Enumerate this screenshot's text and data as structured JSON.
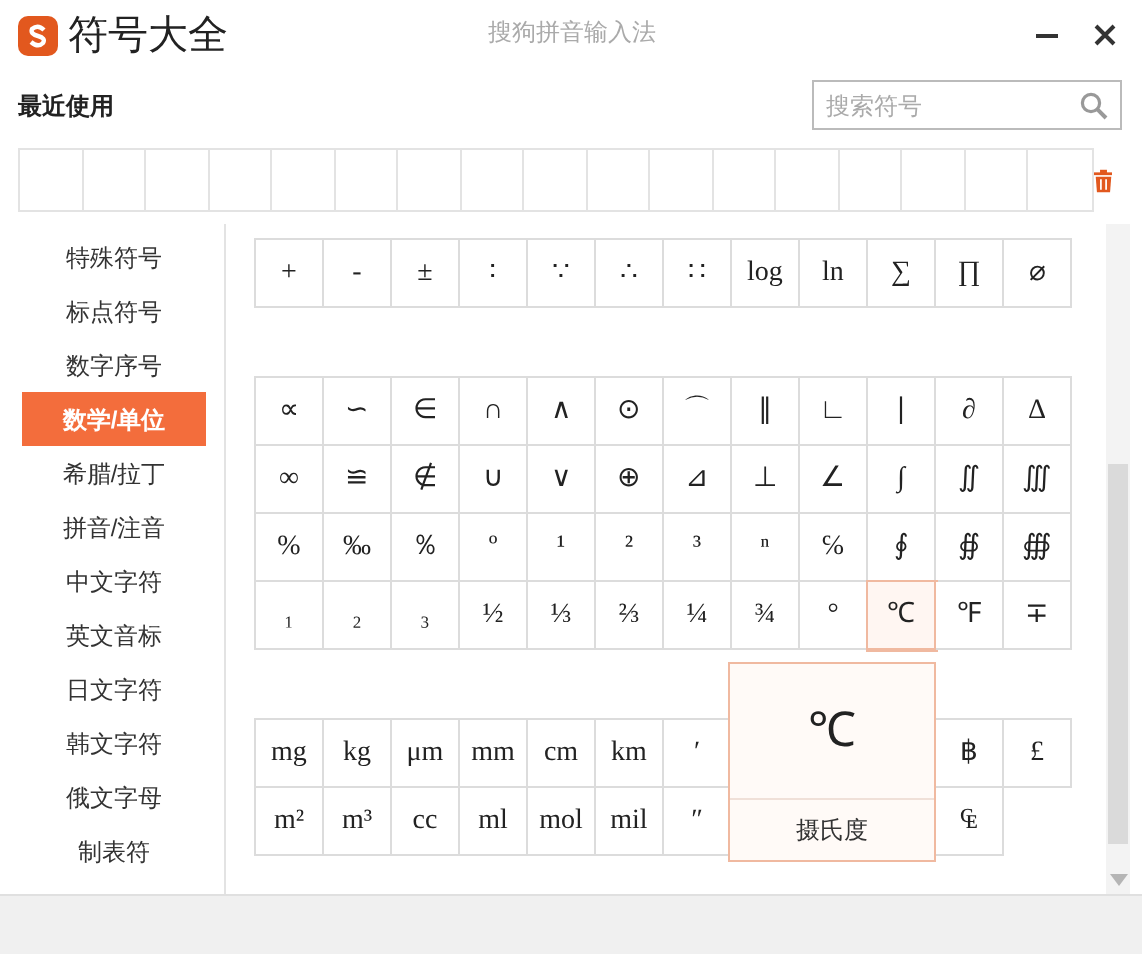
{
  "window": {
    "title": "符号大全",
    "app_name": "搜狗拼音输入法"
  },
  "recent": {
    "label": "最近使用"
  },
  "search": {
    "placeholder": "搜索符号"
  },
  "sidebar": {
    "items": [
      {
        "label": "特殊符号",
        "selected": false
      },
      {
        "label": "标点符号",
        "selected": false
      },
      {
        "label": "数字序号",
        "selected": false
      },
      {
        "label": "数学/单位",
        "selected": true
      },
      {
        "label": "希腊/拉丁",
        "selected": false
      },
      {
        "label": "拼音/注音",
        "selected": false
      },
      {
        "label": "中文字符",
        "selected": false
      },
      {
        "label": "英文音标",
        "selected": false
      },
      {
        "label": "日文字符",
        "selected": false
      },
      {
        "label": "韩文字符",
        "selected": false
      },
      {
        "label": "俄文字母",
        "selected": false
      },
      {
        "label": "制表符",
        "selected": false
      }
    ]
  },
  "groups": [
    {
      "rows": [
        [
          {
            "kind": "symbol",
            "text": "+",
            "selected": false
          },
          {
            "kind": "symbol",
            "text": "-",
            "selected": false
          },
          {
            "kind": "symbol",
            "text": "±",
            "selected": false
          },
          {
            "kind": "symbol",
            "text": "∶",
            "selected": false
          },
          {
            "kind": "symbol",
            "text": "∵",
            "selected": false
          },
          {
            "kind": "symbol",
            "text": "∴",
            "selected": false
          },
          {
            "kind": "symbol",
            "text": "∷",
            "selected": false
          },
          {
            "kind": "symbol",
            "text": "log",
            "selected": false
          },
          {
            "kind": "symbol",
            "text": "ln",
            "selected": false
          },
          {
            "kind": "symbol",
            "text": "∑",
            "selected": false
          },
          {
            "kind": "symbol",
            "text": "∏",
            "selected": false
          },
          {
            "kind": "symbol",
            "text": "⌀",
            "selected": false
          }
        ]
      ]
    },
    {
      "rows": [
        [
          {
            "kind": "symbol",
            "text": "∝",
            "selected": false
          },
          {
            "kind": "symbol",
            "text": "∽",
            "selected": false
          },
          {
            "kind": "symbol",
            "text": "∈",
            "selected": false
          },
          {
            "kind": "symbol",
            "text": "∩",
            "selected": false
          },
          {
            "kind": "symbol",
            "text": "∧",
            "selected": false
          },
          {
            "kind": "symbol",
            "text": "⊙",
            "selected": false
          },
          {
            "kind": "symbol",
            "text": "⌒",
            "selected": false
          },
          {
            "kind": "symbol",
            "text": "∥",
            "selected": false
          },
          {
            "kind": "symbol",
            "text": "∟",
            "selected": false
          },
          {
            "kind": "symbol",
            "text": "∣",
            "selected": false
          },
          {
            "kind": "symbol",
            "text": "∂",
            "selected": false
          },
          {
            "kind": "symbol",
            "text": "∆",
            "selected": false
          }
        ],
        [
          {
            "kind": "symbol",
            "text": "∞",
            "selected": false
          },
          {
            "kind": "symbol",
            "text": "≌",
            "selected": false
          },
          {
            "kind": "symbol",
            "text": "∉",
            "selected": false
          },
          {
            "kind": "symbol",
            "text": "∪",
            "selected": false
          },
          {
            "kind": "symbol",
            "text": "∨",
            "selected": false
          },
          {
            "kind": "symbol",
            "text": "⊕",
            "selected": false
          },
          {
            "kind": "symbol",
            "text": "⊿",
            "selected": false
          },
          {
            "kind": "symbol",
            "text": "⊥",
            "selected": false
          },
          {
            "kind": "symbol",
            "text": "∠",
            "selected": false
          },
          {
            "kind": "symbol",
            "text": "∫",
            "selected": false
          },
          {
            "kind": "symbol",
            "text": "∬",
            "selected": false
          },
          {
            "kind": "symbol",
            "text": "∭",
            "selected": false
          }
        ],
        [
          {
            "kind": "symbol",
            "text": "%",
            "selected": false
          },
          {
            "kind": "symbol",
            "text": "‰",
            "selected": false
          },
          {
            "kind": "symbol",
            "text": "％",
            "selected": false
          },
          {
            "kind": "symbol",
            "text": "º",
            "selected": false
          },
          {
            "kind": "symbol",
            "text": "¹",
            "selected": false
          },
          {
            "kind": "symbol",
            "text": "²",
            "selected": false
          },
          {
            "kind": "symbol",
            "text": "³",
            "selected": false
          },
          {
            "kind": "symbol",
            "text": "ⁿ",
            "selected": false
          },
          {
            "kind": "symbol",
            "text": "℅",
            "selected": false
          },
          {
            "kind": "symbol",
            "text": "∮",
            "selected": false
          },
          {
            "kind": "symbol",
            "text": "∯",
            "selected": false
          },
          {
            "kind": "symbol",
            "text": "∰",
            "selected": false
          }
        ],
        [
          {
            "kind": "symbol",
            "text": "₁",
            "selected": false
          },
          {
            "kind": "symbol",
            "text": "₂",
            "selected": false
          },
          {
            "kind": "symbol",
            "text": "₃",
            "selected": false
          },
          {
            "kind": "symbol",
            "text": "½",
            "selected": false
          },
          {
            "kind": "symbol",
            "text": "⅓",
            "selected": false
          },
          {
            "kind": "symbol",
            "text": "⅔",
            "selected": false
          },
          {
            "kind": "symbol",
            "text": "¼",
            "selected": false
          },
          {
            "kind": "symbol",
            "text": "¾",
            "selected": false
          },
          {
            "kind": "symbol",
            "text": "°",
            "selected": false
          },
          {
            "kind": "symbol",
            "text": "℃",
            "selected": true
          },
          {
            "kind": "symbol",
            "text": "℉",
            "selected": false
          },
          {
            "kind": "symbol",
            "text": "∓",
            "selected": false
          }
        ]
      ]
    },
    {
      "rows": [
        [
          {
            "kind": "symbol",
            "text": "mg",
            "selected": false
          },
          {
            "kind": "symbol",
            "text": "kg",
            "selected": false
          },
          {
            "kind": "symbol",
            "text": "μm",
            "selected": false
          },
          {
            "kind": "symbol",
            "text": "mm",
            "selected": false
          },
          {
            "kind": "symbol",
            "text": "cm",
            "selected": false
          },
          {
            "kind": "symbol",
            "text": "km",
            "selected": false
          },
          {
            "kind": "symbol",
            "text": "′",
            "selected": false
          },
          {
            "kind": "covered"
          },
          {
            "kind": "covered"
          },
          {
            "kind": "covered"
          },
          {
            "kind": "symbol",
            "text": "฿",
            "selected": false
          },
          {
            "kind": "symbol",
            "text": "£",
            "selected": false
          }
        ],
        [
          {
            "kind": "symbol",
            "text": "m²",
            "selected": false
          },
          {
            "kind": "symbol",
            "text": "m³",
            "selected": false
          },
          {
            "kind": "symbol",
            "text": "cc",
            "selected": false
          },
          {
            "kind": "symbol",
            "text": "ml",
            "selected": false
          },
          {
            "kind": "symbol",
            "text": "mol",
            "selected": false
          },
          {
            "kind": "symbol",
            "text": "mil",
            "selected": false
          },
          {
            "kind": "symbol",
            "text": "″",
            "selected": false
          },
          {
            "kind": "covered"
          },
          {
            "kind": "covered"
          },
          {
            "kind": "covered"
          },
          {
            "kind": "symbol",
            "text": "₠",
            "selected": false
          }
        ]
      ]
    }
  ],
  "popup": {
    "symbol": "℃",
    "name": "摄氏度"
  }
}
